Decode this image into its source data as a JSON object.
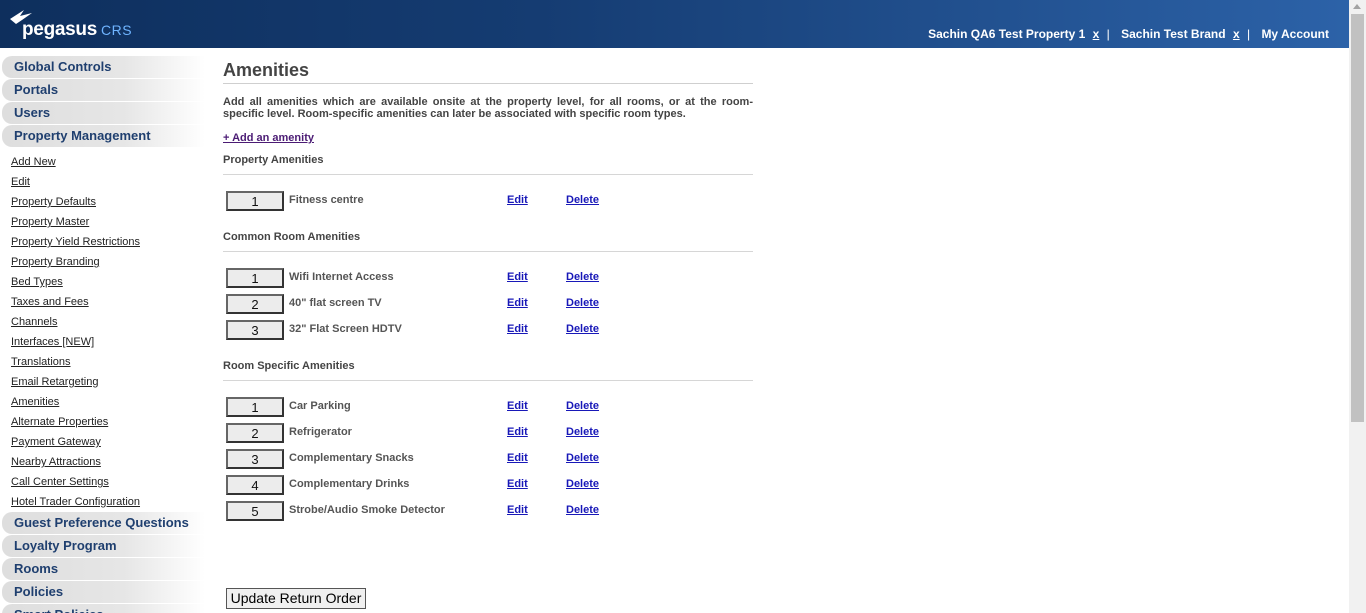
{
  "header": {
    "logo_text": "pegasus",
    "logo_suffix": "CRS",
    "property_name": "Sachin QA6 Test Property 1",
    "property_close": "x",
    "brand_name": "Sachin Test Brand",
    "brand_close": "x",
    "separator": "|",
    "my_account": "My Account"
  },
  "sidebar": {
    "sections_top": [
      {
        "label": "Global Controls"
      },
      {
        "label": "Portals"
      },
      {
        "label": "Users"
      },
      {
        "label": "Property Management"
      }
    ],
    "property_items": [
      {
        "label": "Add New"
      },
      {
        "label": "Edit"
      },
      {
        "label": "Property Defaults"
      },
      {
        "label": "Property Master"
      },
      {
        "label": "Property Yield Restrictions"
      },
      {
        "label": "Property Branding"
      },
      {
        "label": "Bed Types"
      },
      {
        "label": "Taxes and Fees"
      },
      {
        "label": "Channels"
      },
      {
        "label": "Interfaces [NEW]"
      },
      {
        "label": "Translations"
      },
      {
        "label": "Email Retargeting"
      },
      {
        "label": "Amenities"
      },
      {
        "label": "Alternate Properties"
      },
      {
        "label": "Payment Gateway"
      },
      {
        "label": "Nearby Attractions"
      },
      {
        "label": "Call Center Settings"
      },
      {
        "label": "Hotel Trader Configuration"
      }
    ],
    "sections_bottom": [
      {
        "label": "Guest Preference Questions"
      },
      {
        "label": "Loyalty Program"
      },
      {
        "label": "Rooms"
      },
      {
        "label": "Policies"
      },
      {
        "label": "Smart Policies"
      }
    ]
  },
  "main": {
    "title": "Amenities",
    "intro": "Add all amenities which are available onsite at the property level, for all rooms, or at the room-specific level. Room-specific amenities can later be associated with specific room types.",
    "add_link": "+ Add an amenity",
    "edit_label": "Edit",
    "delete_label": "Delete",
    "groups": [
      {
        "title": "Property Amenities",
        "items": [
          {
            "order": "1",
            "name": "Fitness centre"
          }
        ]
      },
      {
        "title": "Common Room Amenities",
        "items": [
          {
            "order": "1",
            "name": "Wifi Internet Access"
          },
          {
            "order": "2",
            "name": "40\" flat screen TV"
          },
          {
            "order": "3",
            "name": "32\" Flat Screen HDTV"
          }
        ]
      },
      {
        "title": "Room Specific Amenities",
        "items": [
          {
            "order": "1",
            "name": "Car Parking"
          },
          {
            "order": "2",
            "name": "Refrigerator"
          },
          {
            "order": "3",
            "name": "Complementary Snacks"
          },
          {
            "order": "4",
            "name": "Complementary Drinks"
          },
          {
            "order": "5",
            "name": "Strobe/Audio Smoke Detector"
          }
        ]
      }
    ],
    "update_button": "Update Return Order"
  }
}
